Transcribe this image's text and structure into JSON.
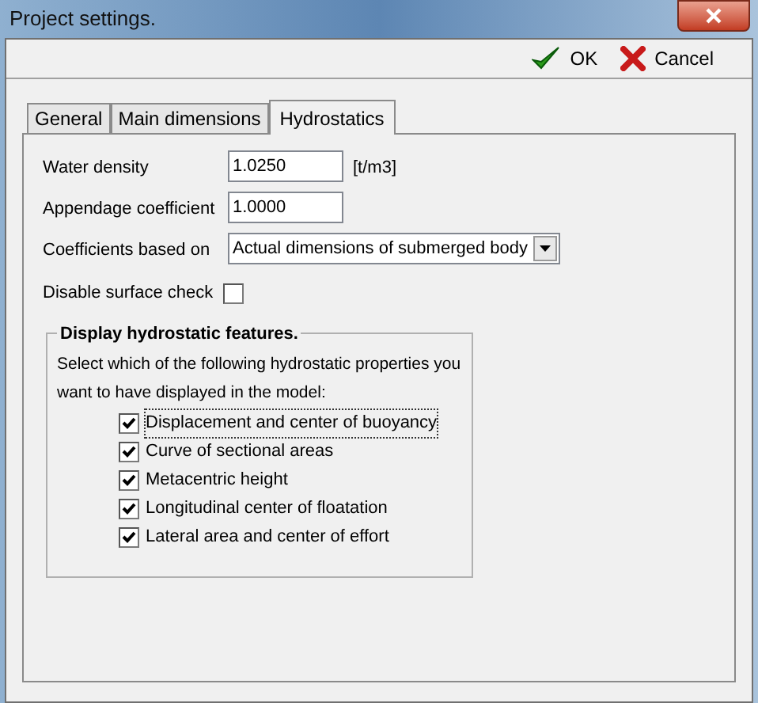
{
  "window": {
    "title": "Project settings."
  },
  "toolbar": [
    {
      "kind": "ok",
      "label": "OK"
    },
    {
      "kind": "cancel",
      "label": "Cancel"
    }
  ],
  "tabs": [
    {
      "label": "General",
      "selected": false
    },
    {
      "label": "Main dimensions",
      "selected": false
    },
    {
      "label": "Hydrostatics",
      "selected": true
    }
  ],
  "fields": [
    {
      "label": "Water density",
      "value": "1.0250",
      "unit": "[t/m3]"
    },
    {
      "label": "Appendage coefficient",
      "value": "1.0000"
    }
  ],
  "coefficients": {
    "label": "Coefficients based on",
    "value": "Actual dimensions of submerged body"
  },
  "surface_check": {
    "label": "Disable surface check",
    "checked": false
  },
  "group": {
    "title": "Display hydrostatic features.",
    "description": "Select which of the following hydrostatic properties you want to have displayed in the model:",
    "options": [
      {
        "label": "Displacement and center of buoyancy",
        "checked": true,
        "focused": true
      },
      {
        "label": "Curve of sectional areas",
        "checked": true,
        "focused": false
      },
      {
        "label": "Metacentric height",
        "checked": true,
        "focused": false
      },
      {
        "label": "Longitudinal center of floatation",
        "checked": true,
        "focused": false
      },
      {
        "label": "Lateral area and center of effort",
        "checked": true,
        "focused": false
      }
    ]
  }
}
